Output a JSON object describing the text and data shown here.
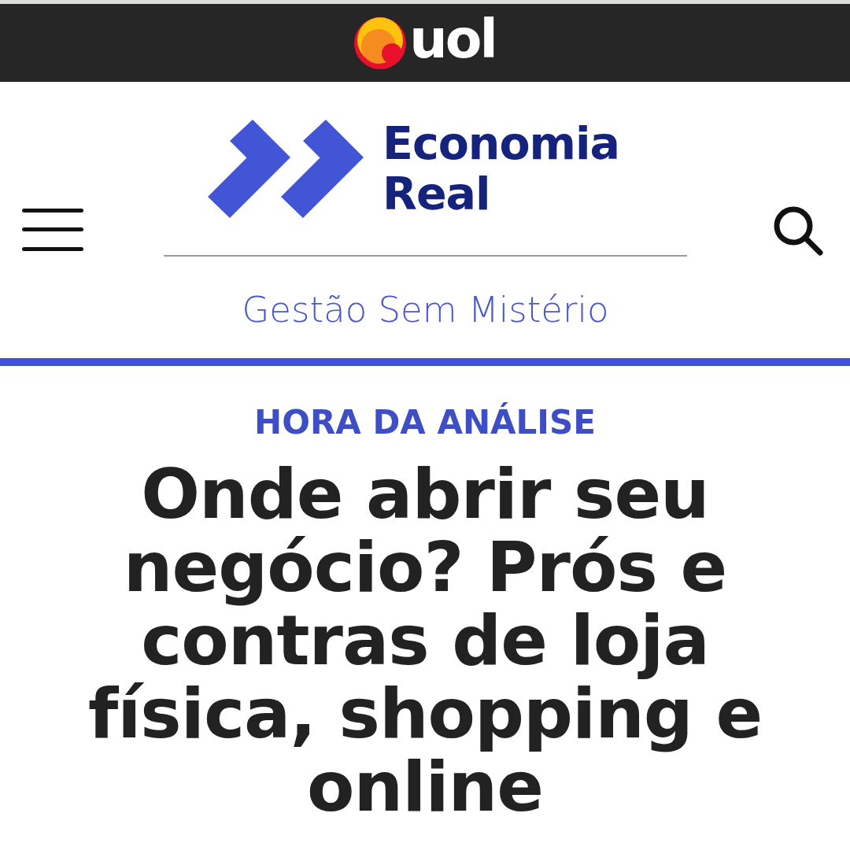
{
  "top_bar": {
    "logo_text": "uol"
  },
  "header": {
    "brand_name": "Economia Real",
    "tagline": "Gestão Sem Mistério"
  },
  "article": {
    "section": "HORA DA ANÁLISE",
    "headline": "Onde abrir seu negócio? Prós e contras de loja física, shopping e online"
  }
}
